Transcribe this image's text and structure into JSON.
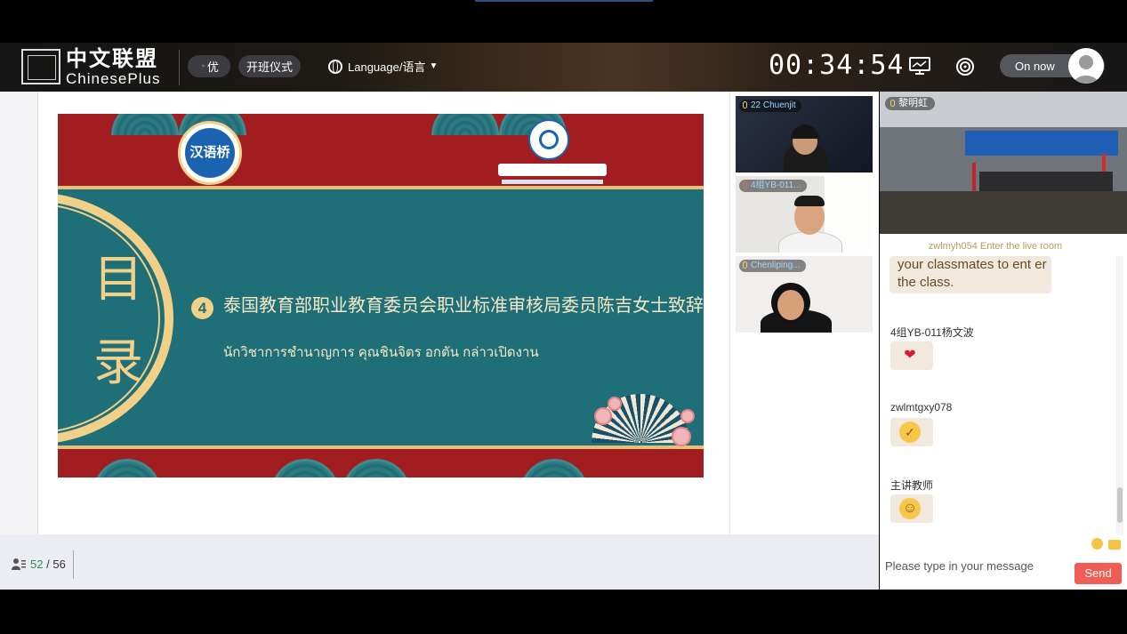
{
  "app": {
    "logo_cn": "中文联盟",
    "logo_en": "ChinesePlus"
  },
  "header": {
    "quality_label": "优",
    "opening_ceremony_label": "开班仪式",
    "language_label": "Language/语言",
    "timer": "00:34:54",
    "on_now_label": "On now"
  },
  "slide": {
    "left_title": "目录",
    "logo_left_text": "汉语桥",
    "item_number": "4",
    "item_title_cn": "泰国教育部职业教育委员会职业标准审核局委员陈吉女士致辞",
    "item_title_th": "นักวิชาการชำนาญการ คุณชินจิตร อกตัน กล่าวเปิดงาน"
  },
  "videos": [
    {
      "name": "22 Chuenjit"
    },
    {
      "name": "4组YB-011..."
    },
    {
      "name": "Chenliping..."
    }
  ],
  "classroom": {
    "name": "黎明虹"
  },
  "chat": {
    "notice": "zwlmyh054 Enter the live room",
    "system_message": "your classmates to ent er the class.",
    "messages": [
      {
        "sender": "4组YB-011杨文波",
        "emoji": "hearts"
      },
      {
        "sender": "zwlmtgxy078",
        "emoji": "thumbs-up"
      },
      {
        "sender": "主讲教师",
        "emoji": "smile"
      }
    ],
    "input_placeholder": "Please type in your message",
    "send_label": "Send"
  },
  "footer": {
    "online_count": "52",
    "separator": "/",
    "total_count": "56"
  },
  "colors": {
    "accent_red": "#ef5d55",
    "slide_teal": "#1f6f78",
    "slide_red": "#a11d1f",
    "slide_gold": "#f2d088"
  }
}
